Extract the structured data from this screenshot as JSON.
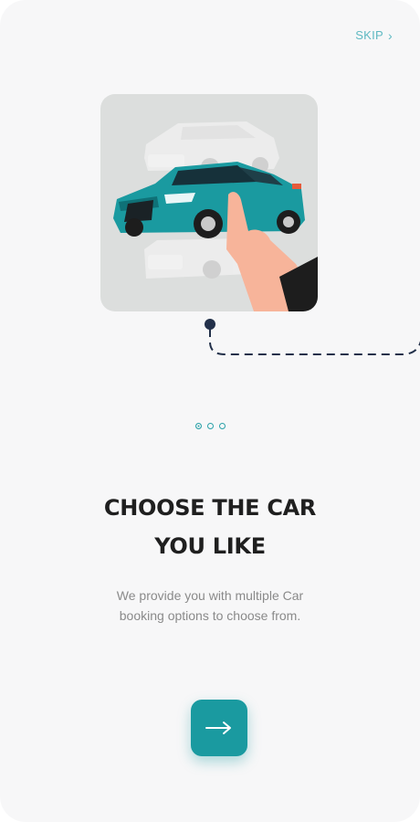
{
  "header": {
    "skip_label": "SKIP",
    "skip_icon": "chevron-right-icon"
  },
  "illustration": {
    "subject": "car-selection-illustration"
  },
  "pagination": {
    "total": 3,
    "active_index": 0
  },
  "content": {
    "title_line1": "CHOOSE THE CAR",
    "title_line2": "YOU LIKE",
    "description_line1": "We provide you with multiple Car",
    "description_line2": "booking options to choose from."
  },
  "next_button": {
    "icon": "arrow-right-icon"
  },
  "colors": {
    "accent": "#1a9aa0",
    "skip": "#5fb9c2",
    "title": "#1f1f1f",
    "description": "#8a8a8a",
    "background": "#f7f7f8"
  }
}
